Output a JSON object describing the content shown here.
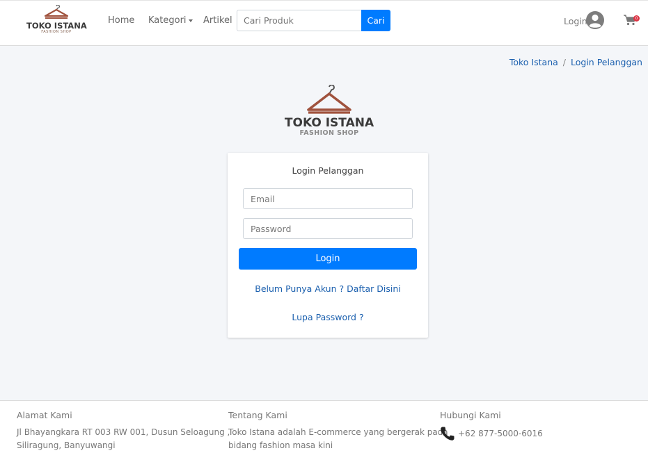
{
  "header": {
    "brand_line1": "TOKO ISTANA",
    "brand_line2": "FASHION SHOP",
    "nav": {
      "home": "Home",
      "kategori": "Kategori",
      "artikel": "Artikel"
    },
    "search": {
      "placeholder": "Cari Produk",
      "button": "Cari"
    },
    "login_label": "Login",
    "cart_count": "0"
  },
  "breadcrumb": {
    "root": "Toko Istana",
    "separator": "/",
    "current": "Login Pelanggan"
  },
  "logo": {
    "line1": "TOKO ISTANA",
    "line2": "FASHION SHOP"
  },
  "login_form": {
    "title": "Login Pelanggan",
    "email_placeholder": "Email",
    "password_placeholder": "Password",
    "submit": "Login",
    "register_link": "Belum Punya Akun ? Daftar Disini",
    "forgot_link": "Lupa Password ?"
  },
  "footer": {
    "address": {
      "heading": "Alamat Kami",
      "line1": "Jl Bhayangkara RT 003 RW 001, Dusun Seloagung ,",
      "line2": "Siliragung, Banyuwangi"
    },
    "about": {
      "heading": "Tentang Kami",
      "line1": "Toko Istana adalah E-commerce yang bergerak pada",
      "line2": "bidang fashion masa kini"
    },
    "contact": {
      "heading": "Hubungi Kami",
      "phone": "+62 877-5000-6016"
    }
  },
  "colors": {
    "primary": "#007bff",
    "link": "#1a5fae",
    "hanger": "#a0523d",
    "badge": "#dc3545"
  }
}
